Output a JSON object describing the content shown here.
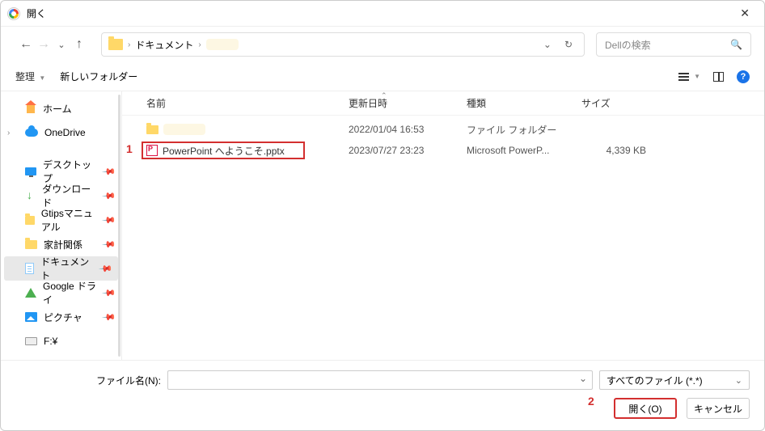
{
  "titlebar": {
    "title": "開く"
  },
  "breadcrumb": {
    "path": "ドキュメント",
    "refresh_icon": "refresh"
  },
  "search": {
    "placeholder": "Dellの検索"
  },
  "toolbar": {
    "organize": "整理",
    "new_folder": "新しいフォルダー"
  },
  "sidebar": {
    "home": "ホーム",
    "onedrive": "OneDrive",
    "items": [
      {
        "label": "デスクトップ"
      },
      {
        "label": "ダウンロード"
      },
      {
        "label": "Gtipsマニュアル"
      },
      {
        "label": "家計関係"
      },
      {
        "label": "ドキュメント"
      },
      {
        "label": "Google ドライ"
      },
      {
        "label": "ピクチャ"
      },
      {
        "label": "F:¥"
      }
    ]
  },
  "columns": {
    "name": "名前",
    "date": "更新日時",
    "type": "種類",
    "size": "サイズ"
  },
  "rows": [
    {
      "name": "",
      "date": "2022/01/04 16:53",
      "type": "ファイル フォルダー",
      "size": ""
    },
    {
      "name": "PowerPoint へようこそ.pptx",
      "date": "2023/07/27 23:23",
      "type": "Microsoft PowerP...",
      "size": "4,339 KB"
    }
  ],
  "footer": {
    "filename_label": "ファイル名(N):",
    "filter": "すべてのファイル (*.*)",
    "open_btn": "開く(O)",
    "cancel_btn": "キャンセル"
  },
  "annotations": {
    "a1": "1",
    "a2": "2"
  }
}
